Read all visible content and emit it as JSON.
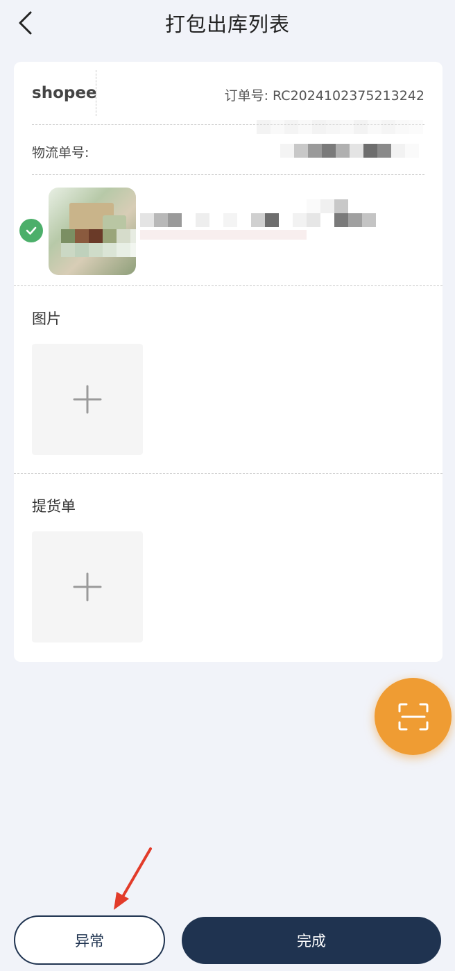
{
  "header": {
    "title": "打包出库列表"
  },
  "order": {
    "shop_name": "shopee",
    "order_no_label": "订单号: RC2024102375213242",
    "logistics_label": "物流单号:"
  },
  "sections": {
    "images_label": "图片",
    "delivery_note_label": "提货单"
  },
  "footer": {
    "exception_label": "异常",
    "finish_label": "完成"
  },
  "colors": {
    "primary": "#1f3350",
    "accent": "#ef9c33",
    "success": "#4caf6a",
    "annotation": "#e23b2a"
  },
  "icons": {
    "back": "chevron-left-icon",
    "check": "check-circle-icon",
    "add": "plus-icon",
    "scan": "scan-icon",
    "annotation": "arrow-icon"
  }
}
